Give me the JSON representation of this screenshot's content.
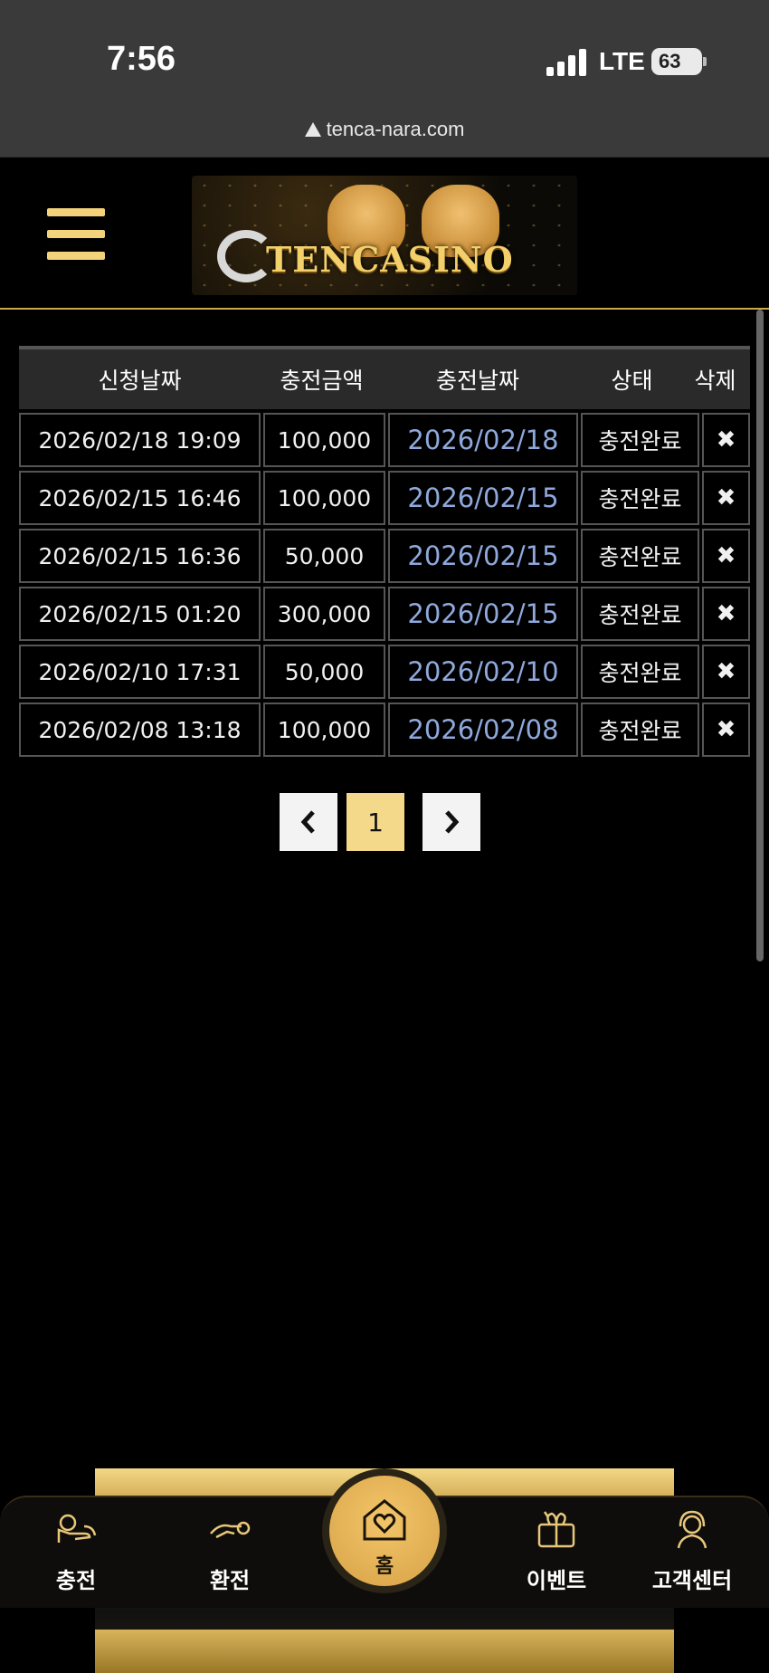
{
  "status_bar": {
    "time": "7:56",
    "network": "LTE",
    "battery": "63"
  },
  "browser": {
    "url": "tenca-nara.com"
  },
  "header": {
    "logo_text": "TENCASINO"
  },
  "table": {
    "headers": [
      "신청날짜",
      "충전금액",
      "충전날짜",
      "상태",
      "삭제"
    ],
    "rows": [
      {
        "requested": "2026/02/18 19:09",
        "amount": "100,000",
        "charged": "2026/02/18",
        "status": "충전완료",
        "delete": "✖"
      },
      {
        "requested": "2026/02/15 16:46",
        "amount": "100,000",
        "charged": "2026/02/15",
        "status": "충전완료",
        "delete": "✖"
      },
      {
        "requested": "2026/02/15 16:36",
        "amount": "50,000",
        "charged": "2026/02/15",
        "status": "충전완료",
        "delete": "✖"
      },
      {
        "requested": "2026/02/15 01:20",
        "amount": "300,000",
        "charged": "2026/02/15",
        "status": "충전완료",
        "delete": "✖"
      },
      {
        "requested": "2026/02/10 17:31",
        "amount": "50,000",
        "charged": "2026/02/10",
        "status": "충전완료",
        "delete": "✖"
      },
      {
        "requested": "2026/02/08 13:18",
        "amount": "100,000",
        "charged": "2026/02/08",
        "status": "충전완료",
        "delete": "✖"
      }
    ]
  },
  "pagination": {
    "prev": "‹",
    "current": "1",
    "next": "›"
  },
  "bottom_nav": {
    "charge": "충전",
    "exchange": "환전",
    "home": "홈",
    "event": "이벤트",
    "support": "고객센터"
  },
  "colors": {
    "accent": "#f5d98b",
    "link": "#8fa9dd",
    "gold": "#d7a246"
  },
  "icons": {
    "charge": "coin-hand-icon",
    "exchange": "exchange-hand-icon",
    "home": "home-heart-icon",
    "event": "gift-icon",
    "support": "headset-icon",
    "menu": "hamburger-menu-icon",
    "delete": "close-icon"
  }
}
